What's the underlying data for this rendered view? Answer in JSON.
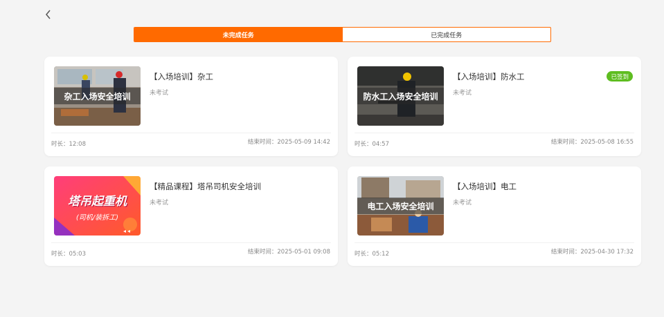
{
  "tabs": [
    {
      "label": "未完成任务",
      "active": true
    },
    {
      "label": "已完成任务",
      "active": false
    }
  ],
  "accent_color": "#ff6a00",
  "badge_color": "#5ebd20",
  "cards": [
    {
      "title": "【入场培训】杂工",
      "thumb_title": "杂工入场安全培训",
      "exam_status": "未考试",
      "badge": "",
      "duration": "时长：12:08",
      "end_time": "结束时间：2025-05-09 14:42"
    },
    {
      "title": "【入场培训】防水工",
      "thumb_title": "防水工入场安全培训",
      "exam_status": "未考试",
      "badge": "已签到",
      "duration": "时长：04:57",
      "end_time": "结束时间：2025-05-08 16:55"
    },
    {
      "title": "【精品课程】塔吊司机安全培训",
      "thumb_title": "塔吊起重机",
      "thumb_subtitle": "(司机/装拆工)",
      "exam_status": "未考试",
      "badge": "",
      "duration": "时长：05:03",
      "end_time": "结束时间：2025-05-01 09:08"
    },
    {
      "title": "【入场培训】电工",
      "thumb_title": "电工入场安全培训",
      "exam_status": "未考试",
      "badge": "",
      "duration": "时长：05:12",
      "end_time": "结束时间：2025-04-30 17:32"
    }
  ]
}
